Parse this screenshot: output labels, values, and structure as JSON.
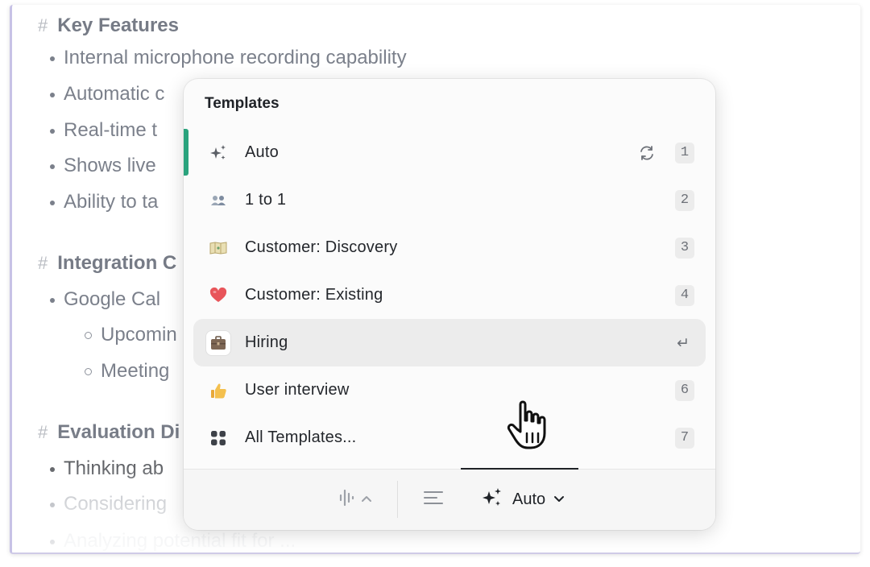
{
  "document": {
    "sections": [
      {
        "heading": "Key Features"
      },
      {
        "heading": "Integration C"
      },
      {
        "heading": "Evaluation Di"
      }
    ],
    "bullets": {
      "b1": "Internal microphone recording capability",
      "b2": "Automatic c",
      "b3": "Real-time t",
      "b4": "Shows live",
      "b5": "Ability to ta",
      "b6": "Google Cal",
      "b7": "Upcomin",
      "b8": "Meeting",
      "b9": "Thinking ab",
      "b10": "Considering",
      "b11": "Analyzing potential fit for ..."
    }
  },
  "popover": {
    "title": "Templates",
    "items": [
      {
        "label": "Auto",
        "key": "1",
        "icon": "sparkles-icon"
      },
      {
        "label": "1 to 1",
        "key": "2",
        "icon": "people-icon"
      },
      {
        "label": "Customer: Discovery",
        "key": "3",
        "icon": "map-icon"
      },
      {
        "label": "Customer: Existing",
        "key": "4",
        "icon": "heart-icon"
      },
      {
        "label": "Hiring",
        "key": "↵",
        "icon": "briefcase-icon",
        "selected": true
      },
      {
        "label": "User interview",
        "key": "6",
        "icon": "thumbs-up-icon"
      },
      {
        "label": "All Templates...",
        "key": "7",
        "icon": "grid-icon"
      }
    ],
    "footer": {
      "mode_label": "Auto"
    }
  },
  "colors": {
    "accent": "#2aa37d",
    "selected_row": "#ececec",
    "heart": "#e8555a"
  }
}
